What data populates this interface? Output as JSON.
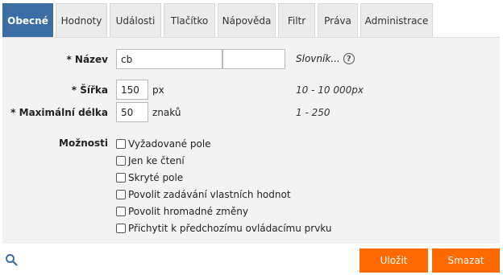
{
  "tabs": [
    {
      "label": "Obecné",
      "active": true
    },
    {
      "label": "Hodnoty"
    },
    {
      "label": "Události"
    },
    {
      "label": "Tlačítko"
    },
    {
      "label": "Nápověda"
    },
    {
      "label": "Filtr"
    },
    {
      "label": "Práva"
    },
    {
      "label": "Administrace"
    }
  ],
  "form": {
    "name_label": "* Název",
    "name_value": "cb",
    "name_value2": "",
    "slovnik_label": "Slovník...",
    "help_glyph": "?",
    "width_label": "* Šířka",
    "width_value": "150",
    "width_unit": "px",
    "width_hint": "10 - 10 000px",
    "maxlen_label": "* Maximální délka",
    "maxlen_value": "50",
    "maxlen_unit": "znaků",
    "maxlen_hint": "1 - 250",
    "options_label": "Možnosti",
    "options": [
      "Vyžadované pole",
      "Jen ke čtení",
      "Skryté pole",
      "Povolit zadávání vlastních hodnot",
      "Povolit hromadné změny",
      "Přichytit k předchozímu ovládacímu prvku"
    ]
  },
  "footer": {
    "save_label": "Uložit",
    "delete_label": "Smazat",
    "accent_color": "#ff6a00"
  },
  "colors": {
    "active_tab": "#3a6ea5",
    "panel_bg": "#f3f3f3"
  }
}
